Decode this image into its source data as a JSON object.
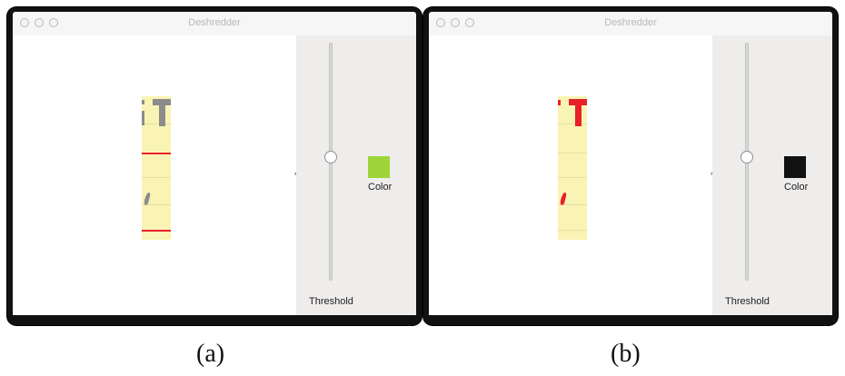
{
  "windows": [
    {
      "title": "Deshredder",
      "threshold_label": "Threshold",
      "color_label": "Color",
      "color": "#9fd53a",
      "threshold_value": 0.52,
      "caption": "(a)",
      "strip_mark_color": "#8c8c8c"
    },
    {
      "title": "Deshredder",
      "threshold_label": "Threshold",
      "color_label": "Color",
      "color": "#111111",
      "threshold_value": 0.52,
      "caption": "(b)",
      "strip_mark_color": "#e8202a"
    }
  ],
  "colors": {
    "strip_background": "#faf4b4",
    "red_rule": "#e8202a",
    "window_frame": "#111111",
    "sidebar": "#efedec"
  }
}
